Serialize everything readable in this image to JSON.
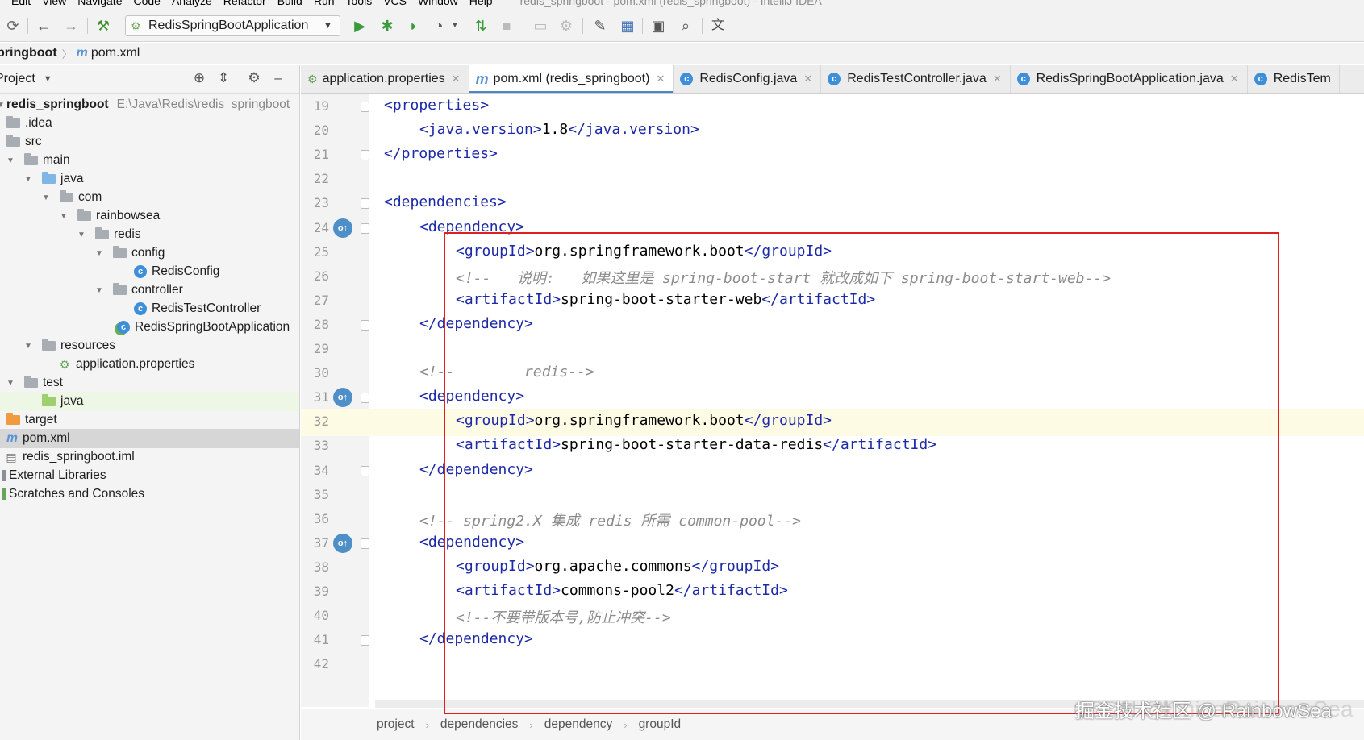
{
  "window_title": "redis_springboot - pom.xml (redis_springboot) - IntelliJ IDEA",
  "menu": [
    "Edit",
    "View",
    "Navigate",
    "Code",
    "Analyze",
    "Refactor",
    "Build",
    "Run",
    "Tools",
    "VCS",
    "Window",
    "Help"
  ],
  "toolbar": {
    "run_config": "RedisSpringBootApplication"
  },
  "navbar": {
    "project": "pringboot",
    "file": "pom.xml"
  },
  "project_panel": {
    "title": "Project",
    "tree": [
      {
        "label": "redis_springboot",
        "path": "E:\\Java\\Redis\\redis_springboot"
      },
      {
        "label": ".idea"
      },
      {
        "label": "src"
      },
      {
        "label": "main"
      },
      {
        "label": "java"
      },
      {
        "label": "com"
      },
      {
        "label": "rainbowsea"
      },
      {
        "label": "redis"
      },
      {
        "label": "config"
      },
      {
        "label": "RedisConfig"
      },
      {
        "label": "controller"
      },
      {
        "label": "RedisTestController"
      },
      {
        "label": "RedisSpringBootApplication"
      },
      {
        "label": "resources"
      },
      {
        "label": "application.properties"
      },
      {
        "label": "test"
      },
      {
        "label": "java"
      },
      {
        "label": "target"
      },
      {
        "label": "pom.xml"
      },
      {
        "label": "redis_springboot.iml"
      },
      {
        "label": "External Libraries"
      },
      {
        "label": "Scratches and Consoles"
      }
    ]
  },
  "tabs": [
    {
      "label": "application.properties"
    },
    {
      "label": "pom.xml (redis_springboot)"
    },
    {
      "label": "RedisConfig.java"
    },
    {
      "label": "RedisTestController.java"
    },
    {
      "label": "RedisSpringBootApplication.java"
    },
    {
      "label": "RedisTem"
    }
  ],
  "editor": {
    "lines": [
      {
        "n": "19",
        "code": "<properties>"
      },
      {
        "n": "20",
        "code": "<java.version>1.8</java.version>"
      },
      {
        "n": "21",
        "code": "</properties>"
      },
      {
        "n": "22",
        "code": ""
      },
      {
        "n": "23",
        "code": "<dependencies>"
      },
      {
        "n": "24",
        "code": "<dependency>"
      },
      {
        "n": "25",
        "code": "<groupId>org.springframework.boot</groupId>"
      },
      {
        "n": "26",
        "code": "<!--   说明:   如果这里是 spring-boot-start 就改成如下 spring-boot-start-web-->"
      },
      {
        "n": "27",
        "code": "<artifactId>spring-boot-starter-web</artifactId>"
      },
      {
        "n": "28",
        "code": "</dependency>"
      },
      {
        "n": "29",
        "code": ""
      },
      {
        "n": "30",
        "code": "<!--        redis-->"
      },
      {
        "n": "31",
        "code": "<dependency>"
      },
      {
        "n": "32",
        "code": "<groupId>org.springframework.boot</groupId>"
      },
      {
        "n": "33",
        "code": "<artifactId>spring-boot-starter-data-redis</artifactId>"
      },
      {
        "n": "34",
        "code": "</dependency>"
      },
      {
        "n": "35",
        "code": ""
      },
      {
        "n": "36",
        "code": "<!-- spring2.X 集成 redis 所需 common-pool-->"
      },
      {
        "n": "37",
        "code": "<dependency>"
      },
      {
        "n": "38",
        "code": "<groupId>org.apache.commons</groupId>"
      },
      {
        "n": "39",
        "code": "<artifactId>commons-pool2</artifactId>"
      },
      {
        "n": "40",
        "code": "<!--不要带版本号,防止冲突-->"
      },
      {
        "n": "41",
        "code": "</dependency>"
      },
      {
        "n": "42",
        "code": ""
      }
    ]
  },
  "breadcrumbs": [
    "project",
    "dependencies",
    "dependency",
    "groupId"
  ],
  "watermark": "掘金技术社区 @ RainbowSea",
  "watermark_bg": "CSDN @ChinaRainbowSea",
  "colors": {
    "tag": "#1d2aa8",
    "comment": "#8c8c8c",
    "highlight_box": "#e02020",
    "accent": "#4a86c7"
  }
}
